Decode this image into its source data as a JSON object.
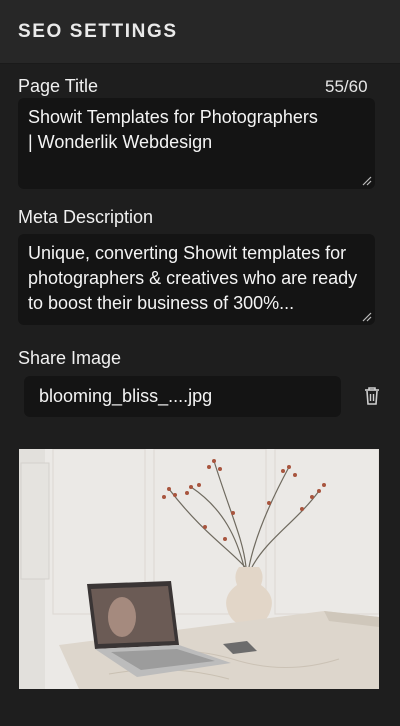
{
  "panel": {
    "title": "SEO SETTINGS"
  },
  "page_title": {
    "label": "Page Title",
    "counter": "55/60",
    "value_line1": "Showit Templates for Photographers",
    "value_line2": "| Wonderlik Webdesign"
  },
  "meta_description": {
    "label": "Meta Description",
    "value": "Unique, converting Showit templates for photographers & creatives who are ready to boost their business of 300%..."
  },
  "share_image": {
    "label": "Share Image",
    "file_name": "blooming_bliss_....jpg"
  },
  "icons": {
    "delete": "trash-icon",
    "resize": "resize-grip-icon"
  },
  "colors": {
    "panel_bg": "#1e1e1e",
    "header_bg": "#272727",
    "input_bg": "#141414",
    "text": "#f2f2f2"
  }
}
